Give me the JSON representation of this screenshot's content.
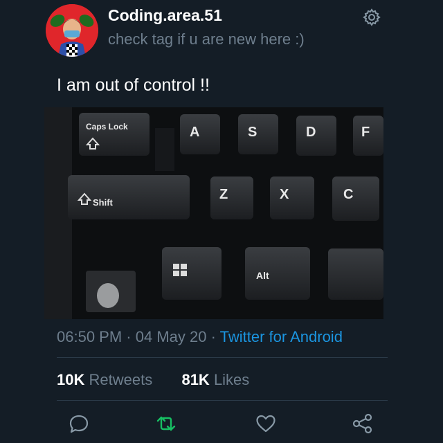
{
  "user": {
    "name": "Coding.area.51",
    "bio": "check tag if u are new here :)"
  },
  "tweet": {
    "text": "I am out of control !!",
    "image_keys": [
      "Caps Lock",
      "A",
      "S",
      "D",
      "F",
      "Shift",
      "Z",
      "X",
      "C",
      "Alt"
    ]
  },
  "meta": {
    "time": "06:50 PM",
    "sep1": " · ",
    "date": "04 May 20",
    "sep2": " · ",
    "source": "Twitter for Android"
  },
  "stats": {
    "retweets_count": "10K",
    "retweets_label": "Retweets",
    "likes_count": "81K",
    "likes_label": "Likes"
  },
  "colors": {
    "background": "#141d26",
    "secondary_text": "#6e7e8d",
    "link": "#1b95e0",
    "retweet_green": "#17bf63"
  },
  "icons": [
    "settings-gear-icon",
    "reply-icon",
    "retweet-icon",
    "like-heart-icon",
    "share-icon"
  ]
}
